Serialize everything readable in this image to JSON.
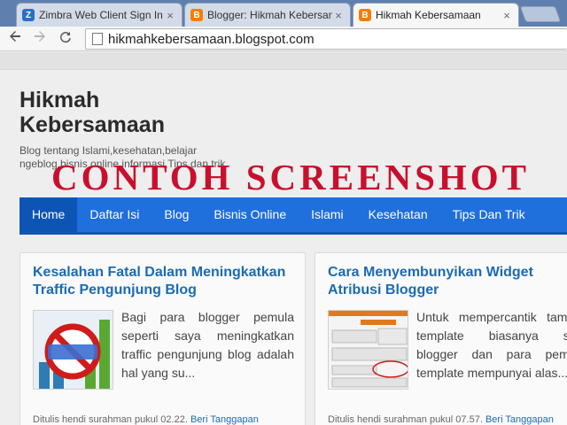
{
  "browser": {
    "tabs": [
      {
        "label": "Zimbra Web Client Sign In",
        "favicon": "zimbra-icon",
        "active": false
      },
      {
        "label": "Blogger: Hikmah Kebersamaan",
        "favicon": "blogger-icon",
        "active": false
      },
      {
        "label": "Hikmah Kebersamaan",
        "favicon": "blogger-icon",
        "active": true
      }
    ],
    "close_glyph": "×",
    "url": "hikmahkebersamaan.blogspot.com",
    "icons": {
      "back": "back-arrow-icon",
      "forward": "forward-arrow-icon",
      "reload": "reload-icon",
      "page": "page-icon"
    }
  },
  "blog": {
    "title": "Hikmah Kebersamaan",
    "description": "Blog tentang Islami,kesehatan,belajar ngeblog,bisnis online,informasi,Tips dan trik",
    "watermark": "CONTOH SCREENSHOT",
    "menu": [
      "Home",
      "Daftar Isi",
      "Blog",
      "Bisnis Online",
      "Islami",
      "Kesehatan",
      "Tips Dan Trik"
    ],
    "active_menu": "Home"
  },
  "posts": [
    {
      "title": "Kesalahan Fatal Dalam Meningkatkan Traffic Pengunjung Blog",
      "excerpt": "Bagi para blogger pemula seperti saya meningkatkan traffic pengunjung blog adalah hal yang su...",
      "meta_prefix": "Ditulis hendi surahman pukul 02.22.",
      "meta_link": "Beri Tanggapan",
      "thumbnail": "stop-sign-chart-image"
    },
    {
      "title": "Cara Menyembunyikan Widget Atribusi Blogger",
      "excerpt": "Untuk mempercantik tampilan template biasanya sobat blogger dan para pembuat template mempunyai alas...",
      "meta_prefix": "Ditulis hendi surahman pukul 07.57.",
      "meta_link": "Beri Tanggapan",
      "thumbnail": "blogger-layout-screenshot-image"
    }
  ],
  "colors": {
    "menu": "#1f6fdc",
    "menu_active": "#0d55b5",
    "post_title": "#1b6bb3",
    "watermark": "#c8102e",
    "tabbar": "#5f7fae"
  }
}
